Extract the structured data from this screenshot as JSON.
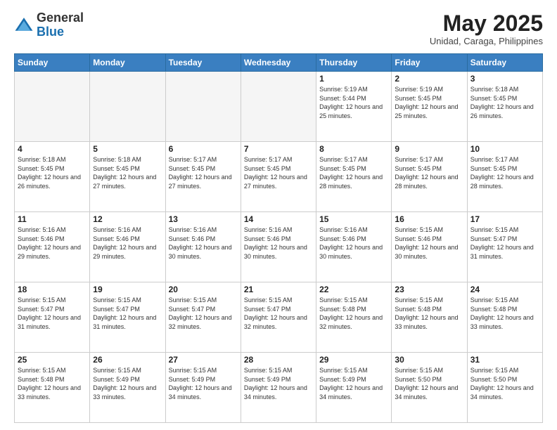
{
  "header": {
    "logo": {
      "general": "General",
      "blue": "Blue"
    },
    "title": "May 2025",
    "location": "Unidad, Caraga, Philippines"
  },
  "days_of_week": [
    "Sunday",
    "Monday",
    "Tuesday",
    "Wednesday",
    "Thursday",
    "Friday",
    "Saturday"
  ],
  "weeks": [
    [
      {
        "day": "",
        "empty": true
      },
      {
        "day": "",
        "empty": true
      },
      {
        "day": "",
        "empty": true
      },
      {
        "day": "",
        "empty": true
      },
      {
        "day": "1",
        "sunrise": "5:19 AM",
        "sunset": "5:44 PM",
        "daylight": "12 hours and 25 minutes."
      },
      {
        "day": "2",
        "sunrise": "5:19 AM",
        "sunset": "5:45 PM",
        "daylight": "12 hours and 25 minutes."
      },
      {
        "day": "3",
        "sunrise": "5:18 AM",
        "sunset": "5:45 PM",
        "daylight": "12 hours and 26 minutes."
      }
    ],
    [
      {
        "day": "4",
        "sunrise": "5:18 AM",
        "sunset": "5:45 PM",
        "daylight": "12 hours and 26 minutes."
      },
      {
        "day": "5",
        "sunrise": "5:18 AM",
        "sunset": "5:45 PM",
        "daylight": "12 hours and 27 minutes."
      },
      {
        "day": "6",
        "sunrise": "5:17 AM",
        "sunset": "5:45 PM",
        "daylight": "12 hours and 27 minutes."
      },
      {
        "day": "7",
        "sunrise": "5:17 AM",
        "sunset": "5:45 PM",
        "daylight": "12 hours and 27 minutes."
      },
      {
        "day": "8",
        "sunrise": "5:17 AM",
        "sunset": "5:45 PM",
        "daylight": "12 hours and 28 minutes."
      },
      {
        "day": "9",
        "sunrise": "5:17 AM",
        "sunset": "5:45 PM",
        "daylight": "12 hours and 28 minutes."
      },
      {
        "day": "10",
        "sunrise": "5:17 AM",
        "sunset": "5:45 PM",
        "daylight": "12 hours and 28 minutes."
      }
    ],
    [
      {
        "day": "11",
        "sunrise": "5:16 AM",
        "sunset": "5:46 PM",
        "daylight": "12 hours and 29 minutes."
      },
      {
        "day": "12",
        "sunrise": "5:16 AM",
        "sunset": "5:46 PM",
        "daylight": "12 hours and 29 minutes."
      },
      {
        "day": "13",
        "sunrise": "5:16 AM",
        "sunset": "5:46 PM",
        "daylight": "12 hours and 30 minutes."
      },
      {
        "day": "14",
        "sunrise": "5:16 AM",
        "sunset": "5:46 PM",
        "daylight": "12 hours and 30 minutes."
      },
      {
        "day": "15",
        "sunrise": "5:16 AM",
        "sunset": "5:46 PM",
        "daylight": "12 hours and 30 minutes."
      },
      {
        "day": "16",
        "sunrise": "5:15 AM",
        "sunset": "5:46 PM",
        "daylight": "12 hours and 30 minutes."
      },
      {
        "day": "17",
        "sunrise": "5:15 AM",
        "sunset": "5:47 PM",
        "daylight": "12 hours and 31 minutes."
      }
    ],
    [
      {
        "day": "18",
        "sunrise": "5:15 AM",
        "sunset": "5:47 PM",
        "daylight": "12 hours and 31 minutes."
      },
      {
        "day": "19",
        "sunrise": "5:15 AM",
        "sunset": "5:47 PM",
        "daylight": "12 hours and 31 minutes."
      },
      {
        "day": "20",
        "sunrise": "5:15 AM",
        "sunset": "5:47 PM",
        "daylight": "12 hours and 32 minutes."
      },
      {
        "day": "21",
        "sunrise": "5:15 AM",
        "sunset": "5:47 PM",
        "daylight": "12 hours and 32 minutes."
      },
      {
        "day": "22",
        "sunrise": "5:15 AM",
        "sunset": "5:48 PM",
        "daylight": "12 hours and 32 minutes."
      },
      {
        "day": "23",
        "sunrise": "5:15 AM",
        "sunset": "5:48 PM",
        "daylight": "12 hours and 33 minutes."
      },
      {
        "day": "24",
        "sunrise": "5:15 AM",
        "sunset": "5:48 PM",
        "daylight": "12 hours and 33 minutes."
      }
    ],
    [
      {
        "day": "25",
        "sunrise": "5:15 AM",
        "sunset": "5:48 PM",
        "daylight": "12 hours and 33 minutes."
      },
      {
        "day": "26",
        "sunrise": "5:15 AM",
        "sunset": "5:49 PM",
        "daylight": "12 hours and 33 minutes."
      },
      {
        "day": "27",
        "sunrise": "5:15 AM",
        "sunset": "5:49 PM",
        "daylight": "12 hours and 34 minutes."
      },
      {
        "day": "28",
        "sunrise": "5:15 AM",
        "sunset": "5:49 PM",
        "daylight": "12 hours and 34 minutes."
      },
      {
        "day": "29",
        "sunrise": "5:15 AM",
        "sunset": "5:49 PM",
        "daylight": "12 hours and 34 minutes."
      },
      {
        "day": "30",
        "sunrise": "5:15 AM",
        "sunset": "5:50 PM",
        "daylight": "12 hours and 34 minutes."
      },
      {
        "day": "31",
        "sunrise": "5:15 AM",
        "sunset": "5:50 PM",
        "daylight": "12 hours and 34 minutes."
      }
    ]
  ]
}
